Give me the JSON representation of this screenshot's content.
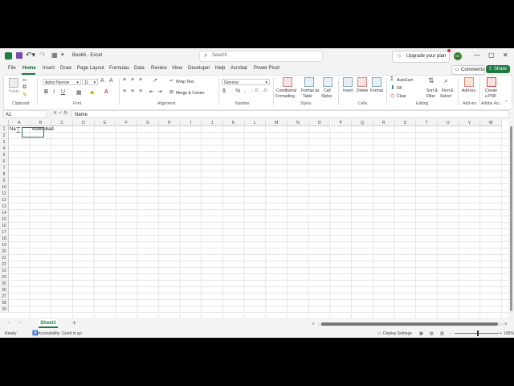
{
  "titlebar": {
    "doc_title": "Book6 - Excel",
    "search_placeholder": "Search",
    "upgrade_label": "Upgrade your plan",
    "avatar_initials": "NV"
  },
  "menu": {
    "items": [
      "File",
      "Home",
      "Insert",
      "Draw",
      "Page Layout",
      "Formulas",
      "Data",
      "Review",
      "View",
      "Developer",
      "Help",
      "Acrobat",
      "Power Pivot"
    ],
    "active": "Home"
  },
  "actions": {
    "comments": "Comments",
    "share": "Share"
  },
  "ribbon": {
    "clipboard": {
      "paste": "Paste",
      "label": "Clipboard"
    },
    "font": {
      "name": "Aptos Narrow",
      "size": "11",
      "label": "Font"
    },
    "alignment": {
      "wrap": "Wrap Text",
      "merge": "Merge & Center",
      "label": "Alignment"
    },
    "number": {
      "format": "General",
      "label": "Number"
    },
    "styles": {
      "conditional": [
        "Conditional",
        "Formatting"
      ],
      "table": [
        "Format as",
        "Table"
      ],
      "cell": [
        "Cell",
        "Styles"
      ],
      "label": "Styles"
    },
    "cells": {
      "insert": "Insert",
      "delete": "Delete",
      "format": "Format",
      "label": "Cells"
    },
    "editing": {
      "autosum": "AutoSum",
      "fill": "Fill",
      "clear": "Clear",
      "sort": [
        "Sort &",
        "Filter"
      ],
      "find": [
        "Find &",
        "Select"
      ],
      "label": "Editing"
    },
    "addins": {
      "btn": "Add-ins",
      "label": "Add-ins"
    },
    "adobe": {
      "btn": [
        "Create",
        "a PDF"
      ],
      "label": "Adobe Acr..."
    }
  },
  "formula": {
    "namebox": "A1",
    "content": "Name"
  },
  "grid": {
    "columns": [
      "A",
      "B",
      "C",
      "D",
      "E",
      "F",
      "G",
      "H",
      "I",
      "J",
      "K",
      "L",
      "M",
      "N",
      "O",
      "P",
      "Q",
      "R",
      "S",
      "T",
      "U",
      "V",
      "W"
    ],
    "rows": [
      "1",
      "2",
      "3",
      "4",
      "5",
      "6",
      "7",
      "8",
      "9",
      "10",
      "11",
      "12",
      "13",
      "14",
      "15",
      "16",
      "17",
      "18",
      "19",
      "20",
      "21",
      "22",
      "23",
      "24",
      "25",
      "26",
      "27",
      "28",
      "29"
    ],
    "a1": "Na",
    "b1": "ooboobad"
  },
  "sheets": {
    "active": "Sheet1",
    "add": "+"
  },
  "status": {
    "ready": "Ready",
    "accessibility": "Accessibility: Good to go",
    "display_settings": "Display Settings",
    "zoom": "100%"
  }
}
